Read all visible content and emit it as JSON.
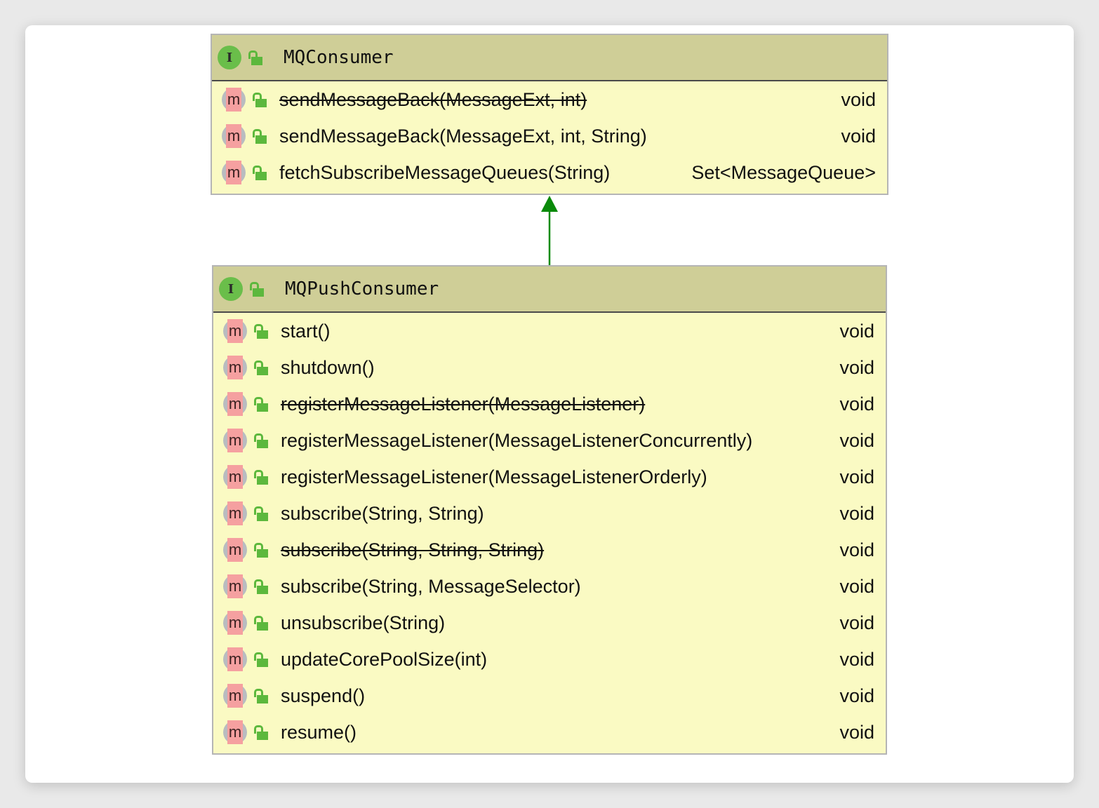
{
  "colors": {
    "header": "#cfce97",
    "body": "#fafac3",
    "arrow": "#0a8a0a",
    "interface_icon": "#6abe4a",
    "lock": "#5cb83d",
    "method_icon": "#f5a0a0"
  },
  "icons": {
    "interface": "I",
    "method": "m"
  },
  "classes": [
    {
      "name": "MQConsumer",
      "kind": "interface",
      "methods": [
        {
          "signature": "sendMessageBack(MessageExt, int)",
          "return": "void",
          "deprecated": true
        },
        {
          "signature": "sendMessageBack(MessageExt, int, String)",
          "return": "void",
          "deprecated": false
        },
        {
          "signature": "fetchSubscribeMessageQueues(String)",
          "return": "Set<MessageQueue>",
          "deprecated": false
        }
      ]
    },
    {
      "name": "MQPushConsumer",
      "kind": "interface",
      "methods": [
        {
          "signature": "start()",
          "return": "void",
          "deprecated": false
        },
        {
          "signature": "shutdown()",
          "return": "void",
          "deprecated": false
        },
        {
          "signature": "registerMessageListener(MessageListener)",
          "return": "void",
          "deprecated": true
        },
        {
          "signature": "registerMessageListener(MessageListenerConcurrently)",
          "return": "void",
          "deprecated": false
        },
        {
          "signature": "registerMessageListener(MessageListenerOrderly)",
          "return": "void",
          "deprecated": false
        },
        {
          "signature": "subscribe(String, String)",
          "return": "void",
          "deprecated": false
        },
        {
          "signature": "subscribe(String, String, String)",
          "return": "void",
          "deprecated": true
        },
        {
          "signature": "subscribe(String, MessageSelector)",
          "return": "void",
          "deprecated": false
        },
        {
          "signature": "unsubscribe(String)",
          "return": "void",
          "deprecated": false
        },
        {
          "signature": "updateCorePoolSize(int)",
          "return": "void",
          "deprecated": false
        },
        {
          "signature": "suspend()",
          "return": "void",
          "deprecated": false
        },
        {
          "signature": "resume()",
          "return": "void",
          "deprecated": false
        }
      ]
    }
  ]
}
